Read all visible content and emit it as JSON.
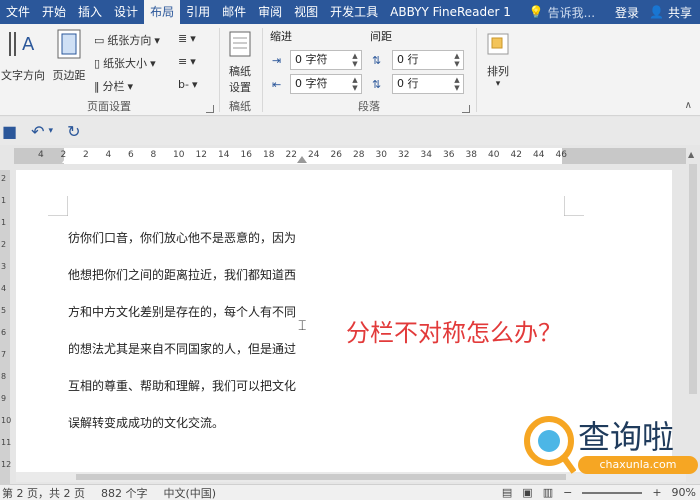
{
  "tabs": {
    "file": "文件",
    "home": "开始",
    "insert": "插入",
    "design": "设计",
    "layout": "布局",
    "references": "引用",
    "mailings": "邮件",
    "review": "审阅",
    "view": "视图",
    "developer": "开发工具",
    "abbyy": "ABBYY FineReader 1"
  },
  "tell_me": "告诉我...",
  "login": "登录",
  "share": "共享",
  "ribbon": {
    "page_setup": {
      "label": "页面设置",
      "text_direction": "文字方向",
      "margins": "页边距",
      "orientation": "纸张方向",
      "size": "纸张大小",
      "columns": "分栏"
    },
    "draft": {
      "label": "稿纸",
      "setting_line1": "稿纸",
      "setting_line2": "设置"
    },
    "paragraph": {
      "label": "段落",
      "indent_title": "缩进",
      "spacing_title": "间距",
      "indent_left": "0 字符",
      "indent_right": "0 字符",
      "spacing_before": "0 行",
      "spacing_after": "0 行"
    },
    "arrange": {
      "label": "排列"
    }
  },
  "document": {
    "lines": [
      "彷你们口音，你们放心他不是恶意的，因为",
      "他想把你们之间的距离拉近，我们都知道西",
      "方和中方文化差别是存在的，每个人有不同",
      "的想法尤其是来自不同国家的人，但是通过",
      "互相的尊重、帮助和理解，我们可以把文化",
      "误解转变成成功的文化交流。"
    ],
    "overlay_title": "分栏不对称怎么办？"
  },
  "ruler": {
    "top": [
      "4",
      "2",
      "2",
      "4",
      "6",
      "8",
      "10",
      "12",
      "14",
      "16",
      "18",
      "22",
      "24",
      "26",
      "28",
      "30",
      "32",
      "34",
      "36",
      "38",
      "40",
      "42",
      "44",
      "46"
    ]
  },
  "vruler": [
    "2",
    "1",
    "1",
    "2",
    "3",
    "4",
    "5",
    "6",
    "7",
    "8",
    "9",
    "10",
    "11",
    "12"
  ],
  "watermark": {
    "brand": "查询啦",
    "url": "chaxunla.com"
  },
  "status": {
    "page": "第 2 页，共 2 页",
    "words": "882 个字",
    "lang": "中文(中国)",
    "zoom": "90%"
  }
}
